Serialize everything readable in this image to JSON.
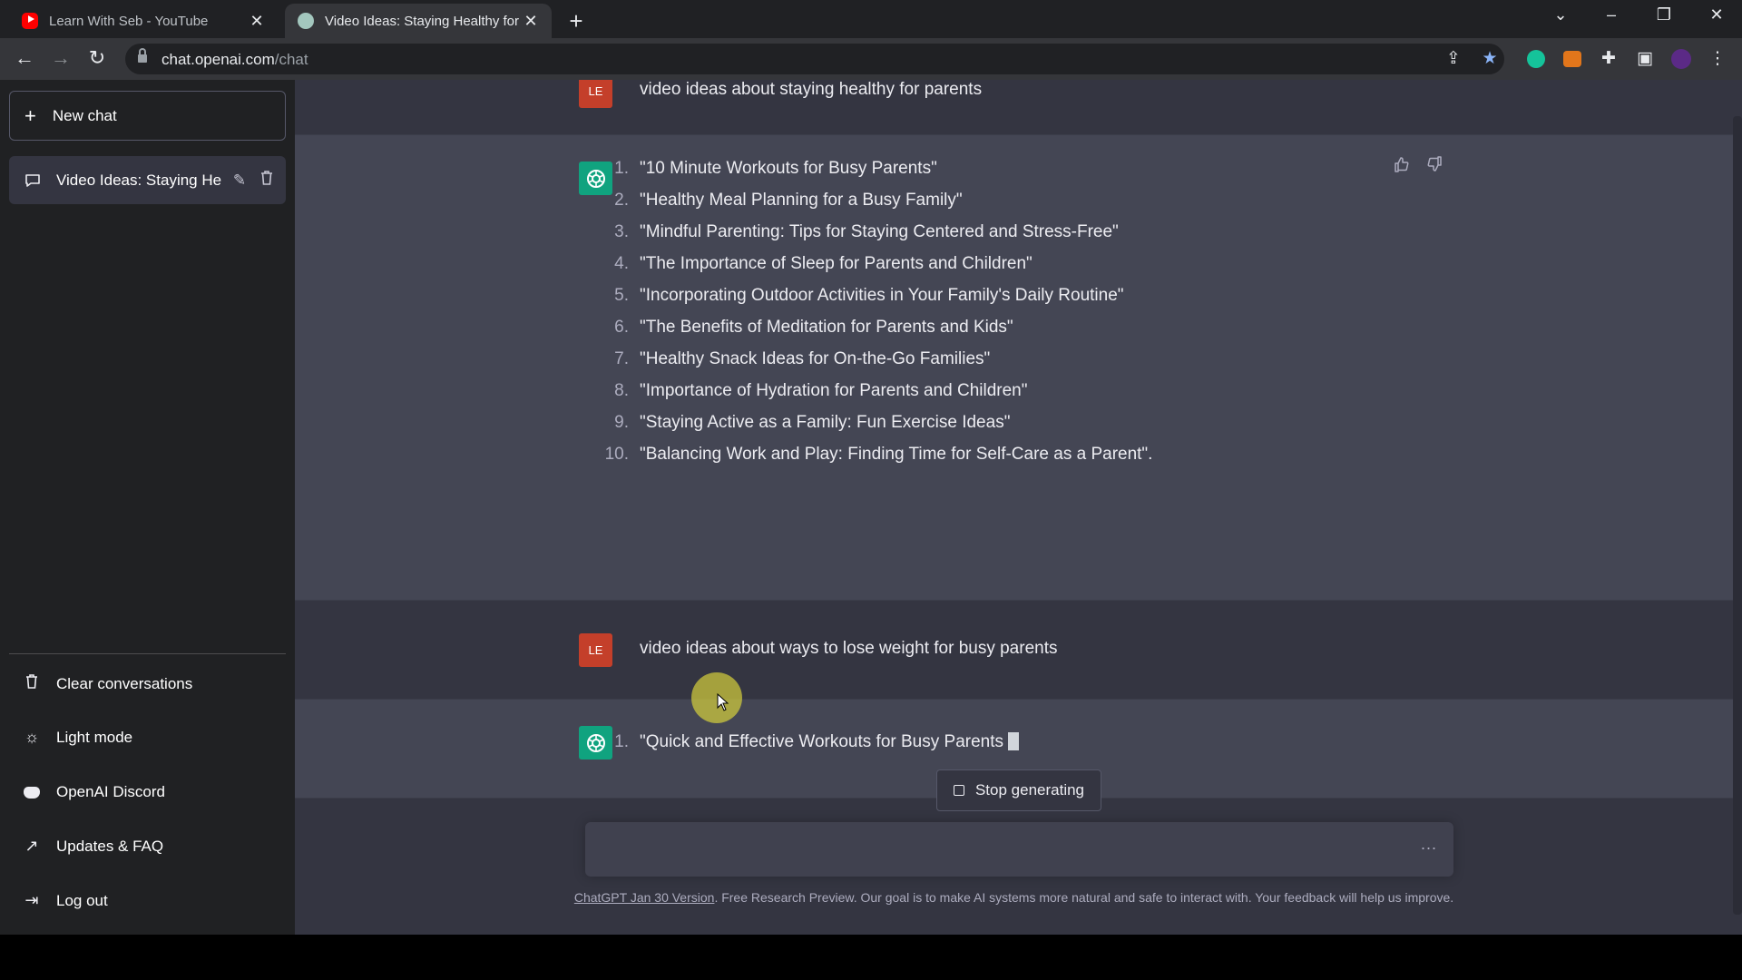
{
  "browser": {
    "tabs": [
      {
        "title": "Learn With Seb - YouTube",
        "icon": "youtube-icon",
        "active": false
      },
      {
        "title": "Video Ideas: Staying Healthy for",
        "icon": "chatgpt-icon",
        "active": true
      }
    ],
    "url_host": "chat.openai.com",
    "url_path": "/chat"
  },
  "sidebar": {
    "new_chat": "New chat",
    "conversation": "Video Ideas: Staying He",
    "items": [
      {
        "label": "Clear conversations",
        "icon": "trash-icon"
      },
      {
        "label": "Light mode",
        "icon": "sun-icon"
      },
      {
        "label": "OpenAI Discord",
        "icon": "discord-icon"
      },
      {
        "label": "Updates & FAQ",
        "icon": "external-link-icon"
      },
      {
        "label": "Log out",
        "icon": "logout-icon"
      }
    ]
  },
  "chat": {
    "user_initials": "LE",
    "prompt_1": "video ideas about staying healthy for parents",
    "reply_1": [
      "\"10 Minute Workouts for Busy Parents\"",
      "\"Healthy Meal Planning for a Busy Family\"",
      "\"Mindful Parenting: Tips for Staying Centered and Stress-Free\"",
      "\"The Importance of Sleep for Parents and Children\"",
      "\"Incorporating Outdoor Activities in Your Family's Daily Routine\"",
      "\"The Benefits of Meditation for Parents and Kids\"",
      "\"Healthy Snack Ideas for On-the-Go Families\"",
      "\"Importance of Hydration for Parents and Children\"",
      "\"Staying Active as a Family: Fun Exercise Ideas\"",
      "\"Balancing Work and Play: Finding Time for Self-Care as a Parent\"."
    ],
    "prompt_2": "video ideas about ways to lose weight for busy parents",
    "reply_2": [
      "\"Quick and Effective Workouts for Busy Parents"
    ]
  },
  "controls": {
    "stop_generating": "Stop generating",
    "input_value": "",
    "dots": "..."
  },
  "footer": {
    "link": "ChatGPT Jan 30 Version",
    "text": ". Free Research Preview. Our goal is to make AI systems more natural and safe to interact with. Your feedback will help us improve."
  },
  "colors": {
    "sidebar_bg": "#202123",
    "main_bg": "#343541",
    "bot_row_bg": "#444654",
    "gpt_avatar": "#10a37f",
    "user_avatar": "#c43f2a"
  }
}
